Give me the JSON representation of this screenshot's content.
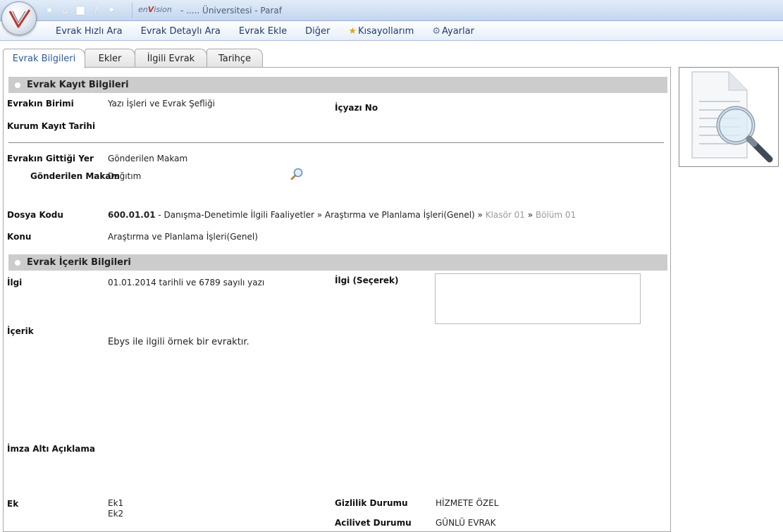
{
  "header": {
    "brand_prefix": "en",
    "brand_x": "V",
    "brand_suffix": "ision",
    "title": "- ..... Üniversitesi - Paraf",
    "quick_icons": [
      "star-icon",
      "home-icon",
      "lock-icon",
      "help-icon",
      "pin-icon"
    ]
  },
  "menu": {
    "items": [
      "Evrak Hızlı Ara",
      "Evrak Detaylı Ara",
      "Evrak Ekle",
      "Diğer"
    ],
    "shortcuts": "Kısayollarım",
    "settings": "Ayarlar"
  },
  "tabs": [
    {
      "label": "Evrak Bilgileri",
      "active": true
    },
    {
      "label": "Ekler",
      "active": false
    },
    {
      "label": "İlgili Evrak",
      "active": false
    },
    {
      "label": "Tarihçe",
      "active": false
    }
  ],
  "sections": {
    "kayit": {
      "title": "Evrak Kayıt Bilgileri",
      "birim_label": "Evrakın Birimi",
      "birim_value": "Yazı İşleri ve Evrak Şefliği",
      "icyazi_label": "İçyazı No",
      "kurum_tarih_label": "Kurum Kayıt Tarihi",
      "gittigi_label": "Evrakın Gittiği Yer",
      "gittigi_value": "Gönderilen Makam",
      "makam_label": "Gönderilen Makam",
      "makam_value": "Dağıtım",
      "dosya_label": "Dosya Kodu",
      "dosya_code": "600.01.01",
      "dosya_path": " - Danışma-Denetimle İlgili Faaliyetler » Araştırma ve Planlama İşleri(Genel) » ",
      "dosya_klasor": "Klasör 01",
      "dosya_sep": " » ",
      "dosya_bolum": "Bölüm 01",
      "konu_label": "Konu",
      "konu_value": "Araştırma ve Planlama İşleri(Genel)"
    },
    "icerik": {
      "title": "Evrak İçerik Bilgileri",
      "ilgi_label": "İlgi",
      "ilgi_value": "01.01.2014 tarihli ve 6789 sayılı yazı",
      "ilgi_secerek_label": "İlgi (Seçerek)",
      "icerik_label": "İçerik",
      "icerik_value": "Ebys ile ilgili örnek bir evraktır.",
      "imza_label": "İmza Altı Açıklama",
      "ek_label": "Ek",
      "ek_values": [
        "Ek1",
        "Ek2"
      ],
      "gizlilik_label": "Gizlilik Durumu",
      "gizlilik_value": "HİZMETE ÖZEL",
      "acilivet_label": "Acilivet Durumu",
      "acilivet_value": "GÜNLÜ EVRAK"
    }
  }
}
